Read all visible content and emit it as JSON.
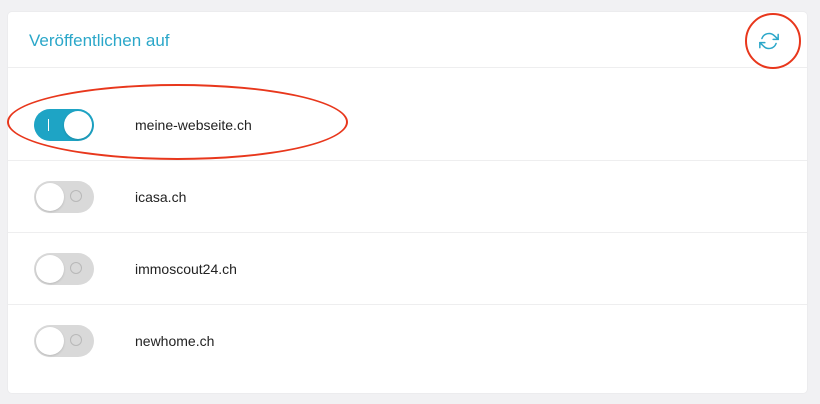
{
  "panel": {
    "title": "Veröffentlichen auf",
    "refresh_icon": "refresh-icon"
  },
  "portals": [
    {
      "label": "meine-webseite.ch",
      "enabled": true
    },
    {
      "label": "icasa.ch",
      "enabled": false
    },
    {
      "label": "immoscout24.ch",
      "enabled": false
    },
    {
      "label": "newhome.ch",
      "enabled": false
    }
  ],
  "colors": {
    "accent": "#2ba7c9",
    "toggle_on": "#1ea4c5",
    "toggle_off": "#d9d9d9",
    "annotation": "#e8371c",
    "background": "#f1f1f3"
  }
}
